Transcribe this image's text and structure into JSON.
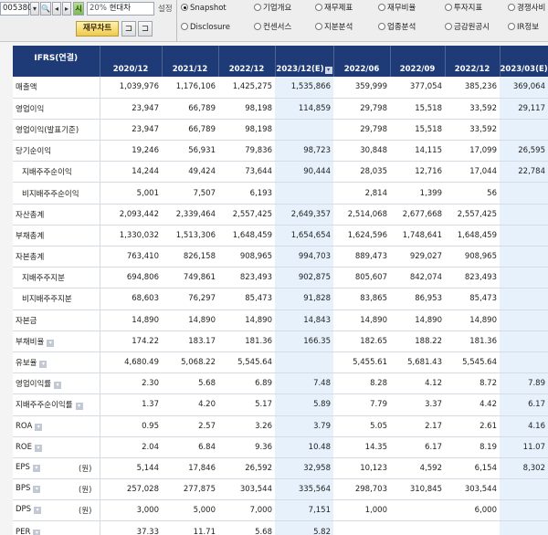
{
  "toolbar": {
    "code": "005380",
    "dd_icon": "▾",
    "search_icon": "🔍",
    "prev_icon": "◂",
    "next_icon": "▸",
    "sim_label": "시",
    "company_pct": "20%",
    "company_name": "현대차",
    "settings_label": "설정",
    "fin_button": "재무차트",
    "icon1": "⊐",
    "icon2": "⊐"
  },
  "tabs": [
    {
      "label": "Snapshot",
      "selected": true
    },
    {
      "label": "기업개요",
      "selected": false
    },
    {
      "label": "재무제표",
      "selected": false
    },
    {
      "label": "재무비율",
      "selected": false
    },
    {
      "label": "투자지표",
      "selected": false
    },
    {
      "label": "경쟁사비",
      "selected": false
    },
    {
      "label": "Disclosure",
      "selected": false
    },
    {
      "label": "컨센서스",
      "selected": false
    },
    {
      "label": "지분분석",
      "selected": false
    },
    {
      "label": "업종분석",
      "selected": false
    },
    {
      "label": "금감원공시",
      "selected": false
    },
    {
      "label": "IR정보",
      "selected": false
    }
  ],
  "table": {
    "corner": "IFRS(연결)",
    "columns": [
      {
        "label": "2020/12",
        "estimate": false
      },
      {
        "label": "2021/12",
        "estimate": false
      },
      {
        "label": "2022/12",
        "estimate": false
      },
      {
        "label": "2023/12(E)",
        "estimate": true
      },
      {
        "label": "2022/06",
        "estimate": false
      },
      {
        "label": "2022/09",
        "estimate": false
      },
      {
        "label": "2022/12",
        "estimate": false
      },
      {
        "label": "2023/03(E)",
        "estimate": true
      }
    ],
    "rows": [
      {
        "label": "매출액",
        "sub": false,
        "unit": "",
        "tag": false,
        "values": [
          "1,039,976",
          "1,176,106",
          "1,425,275",
          "1,535,866",
          "359,999",
          "377,054",
          "385,236",
          "369,064"
        ]
      },
      {
        "label": "영업이익",
        "sub": false,
        "unit": "",
        "tag": false,
        "values": [
          "23,947",
          "66,789",
          "98,198",
          "114,859",
          "29,798",
          "15,518",
          "33,592",
          "29,117"
        ]
      },
      {
        "label": "영업이익(발표기준)",
        "sub": false,
        "unit": "",
        "tag": false,
        "values": [
          "23,947",
          "66,789",
          "98,198",
          "",
          "29,798",
          "15,518",
          "33,592",
          ""
        ]
      },
      {
        "label": "당기순이익",
        "sub": false,
        "unit": "",
        "tag": false,
        "values": [
          "19,246",
          "56,931",
          "79,836",
          "98,723",
          "30,848",
          "14,115",
          "17,099",
          "26,595"
        ]
      },
      {
        "label": "지배주주순이익",
        "sub": true,
        "unit": "",
        "tag": false,
        "values": [
          "14,244",
          "49,424",
          "73,644",
          "90,444",
          "28,035",
          "12,716",
          "17,044",
          "22,784"
        ]
      },
      {
        "label": "비지배주주순이익",
        "sub": true,
        "unit": "",
        "tag": false,
        "values": [
          "5,001",
          "7,507",
          "6,193",
          "",
          "2,814",
          "1,399",
          "56",
          ""
        ]
      },
      {
        "label": "자산총계",
        "sub": false,
        "unit": "",
        "tag": false,
        "values": [
          "2,093,442",
          "2,339,464",
          "2,557,425",
          "2,649,357",
          "2,514,068",
          "2,677,668",
          "2,557,425",
          ""
        ]
      },
      {
        "label": "부채총계",
        "sub": false,
        "unit": "",
        "tag": false,
        "values": [
          "1,330,032",
          "1,513,306",
          "1,648,459",
          "1,654,654",
          "1,624,596",
          "1,748,641",
          "1,648,459",
          ""
        ]
      },
      {
        "label": "자본총계",
        "sub": false,
        "unit": "",
        "tag": false,
        "values": [
          "763,410",
          "826,158",
          "908,965",
          "994,703",
          "889,473",
          "929,027",
          "908,965",
          ""
        ]
      },
      {
        "label": "지배주주지분",
        "sub": true,
        "unit": "",
        "tag": false,
        "values": [
          "694,806",
          "749,861",
          "823,493",
          "902,875",
          "805,607",
          "842,074",
          "823,493",
          ""
        ]
      },
      {
        "label": "비지배주주지분",
        "sub": true,
        "unit": "",
        "tag": false,
        "values": [
          "68,603",
          "76,297",
          "85,473",
          "91,828",
          "83,865",
          "86,953",
          "85,473",
          ""
        ]
      },
      {
        "label": "자본금",
        "sub": false,
        "unit": "",
        "tag": false,
        "values": [
          "14,890",
          "14,890",
          "14,890",
          "14,843",
          "14,890",
          "14,890",
          "14,890",
          ""
        ]
      },
      {
        "label": "부채비율",
        "sub": false,
        "unit": "",
        "tag": true,
        "values": [
          "174.22",
          "183.17",
          "181.36",
          "166.35",
          "182.65",
          "188.22",
          "181.36",
          ""
        ]
      },
      {
        "label": "유보율",
        "sub": false,
        "unit": "",
        "tag": true,
        "values": [
          "4,680.49",
          "5,068.22",
          "5,545.64",
          "",
          "5,455.61",
          "5,681.43",
          "5,545.64",
          ""
        ]
      },
      {
        "label": "영업이익률",
        "sub": false,
        "unit": "",
        "tag": true,
        "values": [
          "2.30",
          "5.68",
          "6.89",
          "7.48",
          "8.28",
          "4.12",
          "8.72",
          "7.89"
        ]
      },
      {
        "label": "지배주주순이익률",
        "sub": false,
        "unit": "",
        "tag": true,
        "values": [
          "1.37",
          "4.20",
          "5.17",
          "5.89",
          "7.79",
          "3.37",
          "4.42",
          "6.17"
        ]
      },
      {
        "label": "ROA",
        "sub": false,
        "unit": "",
        "tag": true,
        "values": [
          "0.95",
          "2.57",
          "3.26",
          "3.79",
          "5.05",
          "2.17",
          "2.61",
          "4.16"
        ]
      },
      {
        "label": "ROE",
        "sub": false,
        "unit": "",
        "tag": true,
        "values": [
          "2.04",
          "6.84",
          "9.36",
          "10.48",
          "14.35",
          "6.17",
          "8.19",
          "11.07"
        ]
      },
      {
        "label": "EPS",
        "sub": false,
        "unit": "(원)",
        "tag": true,
        "values": [
          "5,144",
          "17,846",
          "26,592",
          "32,958",
          "10,123",
          "4,592",
          "6,154",
          "8,302"
        ]
      },
      {
        "label": "BPS",
        "sub": false,
        "unit": "(원)",
        "tag": true,
        "values": [
          "257,028",
          "277,875",
          "303,544",
          "335,564",
          "298,703",
          "310,845",
          "303,544",
          ""
        ]
      },
      {
        "label": "DPS",
        "sub": false,
        "unit": "(원)",
        "tag": true,
        "values": [
          "3,000",
          "5,000",
          "7,000",
          "7,151",
          "1,000",
          "",
          "6,000",
          ""
        ]
      },
      {
        "label": "PER",
        "sub": false,
        "unit": "",
        "tag": true,
        "values": [
          "37.33",
          "11.71",
          "5.68",
          "5.82",
          "",
          "",
          "",
          ""
        ]
      }
    ]
  }
}
